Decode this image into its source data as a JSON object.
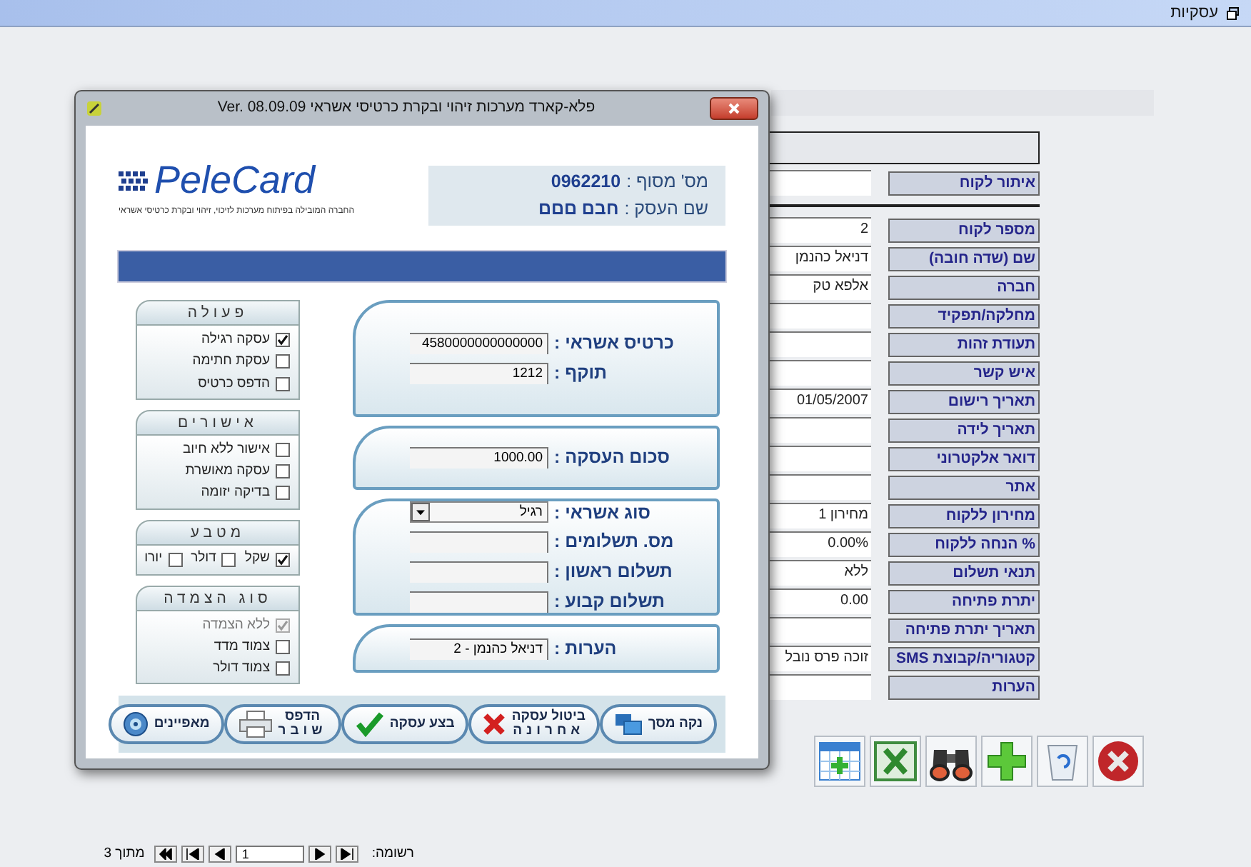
{
  "app_bar": {
    "title": "עסקיות"
  },
  "customer_form": {
    "search_label": "איתור לקוח",
    "fields": [
      {
        "label": "מספר לקוח",
        "value": "2"
      },
      {
        "label": "שם (שדה חובה)",
        "value": "דניאל כהנמן"
      },
      {
        "label": "חברה",
        "value": "אלפא טק"
      },
      {
        "label": "מחלקה/תפקיד"
      },
      {
        "label": "תעודת זהות"
      },
      {
        "label": "איש קשר"
      },
      {
        "label": "תאריך רישום",
        "value": "01/05/2007"
      },
      {
        "label": "תאריך לידה"
      },
      {
        "label": "דואר אלקטרוני"
      },
      {
        "label": "אתר"
      },
      {
        "label": "מחירון ללקוח",
        "value": "מחירון 1"
      },
      {
        "label": "% הנחה ללקוח",
        "value": "0.00%"
      },
      {
        "label": "תנאי תשלום",
        "value": "ללא"
      },
      {
        "label": "יתרת פתיחה",
        "value": "0.00"
      },
      {
        "label": "תאריך יתרת פתיחה"
      },
      {
        "label": "קטגוריה/קבוצת SMS",
        "value": "זוכה פרס נובל"
      },
      {
        "label": "הערות"
      }
    ]
  },
  "record_nav": {
    "label": "רשומה:",
    "current": "1",
    "total": "מתוך 3"
  },
  "dialog": {
    "title": "פלא-קארד מערכות זיהוי ובקרת כרטיסי אשראי Ver. 08.09.09",
    "logo_text": "PeleCard",
    "logo_tagline": "החברה המובילה בפיתוח מערכות לזיכוי, זיהוי ובקרת כרטיסי אשראי",
    "terminal": [
      {
        "label": "מס' מסוף :",
        "value": "0962210"
      },
      {
        "label": "שם העסק :",
        "value": "חבם םםם"
      }
    ],
    "sections": [
      {
        "fields": [
          {
            "kind": "text",
            "label": "כרטיס אשראי :",
            "value": "4580000000000000"
          },
          {
            "kind": "text",
            "label": "תוקף :",
            "value": "1212"
          }
        ]
      },
      {
        "fields": [
          {
            "kind": "text",
            "label": "סכום העסקה :",
            "value": "1000.00"
          }
        ]
      },
      {
        "fields": [
          {
            "kind": "select",
            "label": "סוג אשראי :",
            "value": "רגיל"
          },
          {
            "kind": "text",
            "label": "מס. תשלומים :"
          },
          {
            "kind": "text",
            "label": "תשלום ראשון :"
          },
          {
            "kind": "text",
            "label": "תשלום קבוע :"
          }
        ]
      },
      {
        "fields": [
          {
            "kind": "text",
            "label": "הערות :",
            "value": "דניאל כהנמן - 2"
          }
        ]
      }
    ],
    "option_groups": [
      {
        "kind": "column",
        "title": "פעולה",
        "options": [
          {
            "label": "עסקה רגילה",
            "checked": true
          },
          {
            "label": "עסקת חתימה",
            "checked": false
          },
          {
            "label": "הדפס כרטיס",
            "checked": false
          }
        ]
      },
      {
        "kind": "column",
        "title": "אישורים",
        "options": [
          {
            "label": "אישור ללא חיוב",
            "checked": false
          },
          {
            "label": "עסקה מאושרת",
            "checked": false
          },
          {
            "label": "בדיקה יזומה",
            "checked": false
          }
        ]
      },
      {
        "kind": "row",
        "title": "מטבע",
        "options": [
          {
            "label": "שקל",
            "checked": true
          },
          {
            "label": "דולר",
            "checked": false
          },
          {
            "label": "יורו",
            "checked": false
          }
        ]
      },
      {
        "kind": "column",
        "title": "סוג הצמדה",
        "options": [
          {
            "label": "ללא הצמדה",
            "checked": true,
            "disabled": true
          },
          {
            "label": "צמוד מדד",
            "checked": false,
            "disabled": false
          },
          {
            "label": "צמוד דולר",
            "checked": false,
            "disabled": false
          }
        ]
      }
    ],
    "buttons": [
      {
        "kind": "clear",
        "lines": [
          "נקה מסך"
        ]
      },
      {
        "kind": "cancel",
        "lines": [
          "ביטול עסקה",
          "אחרונה"
        ]
      },
      {
        "kind": "execute",
        "lines": [
          "בצע עסקה"
        ]
      },
      {
        "kind": "print",
        "lines": [
          "הדפס",
          "שובר"
        ]
      },
      {
        "kind": "settings",
        "lines": [
          "מאפיינים"
        ]
      }
    ]
  }
}
